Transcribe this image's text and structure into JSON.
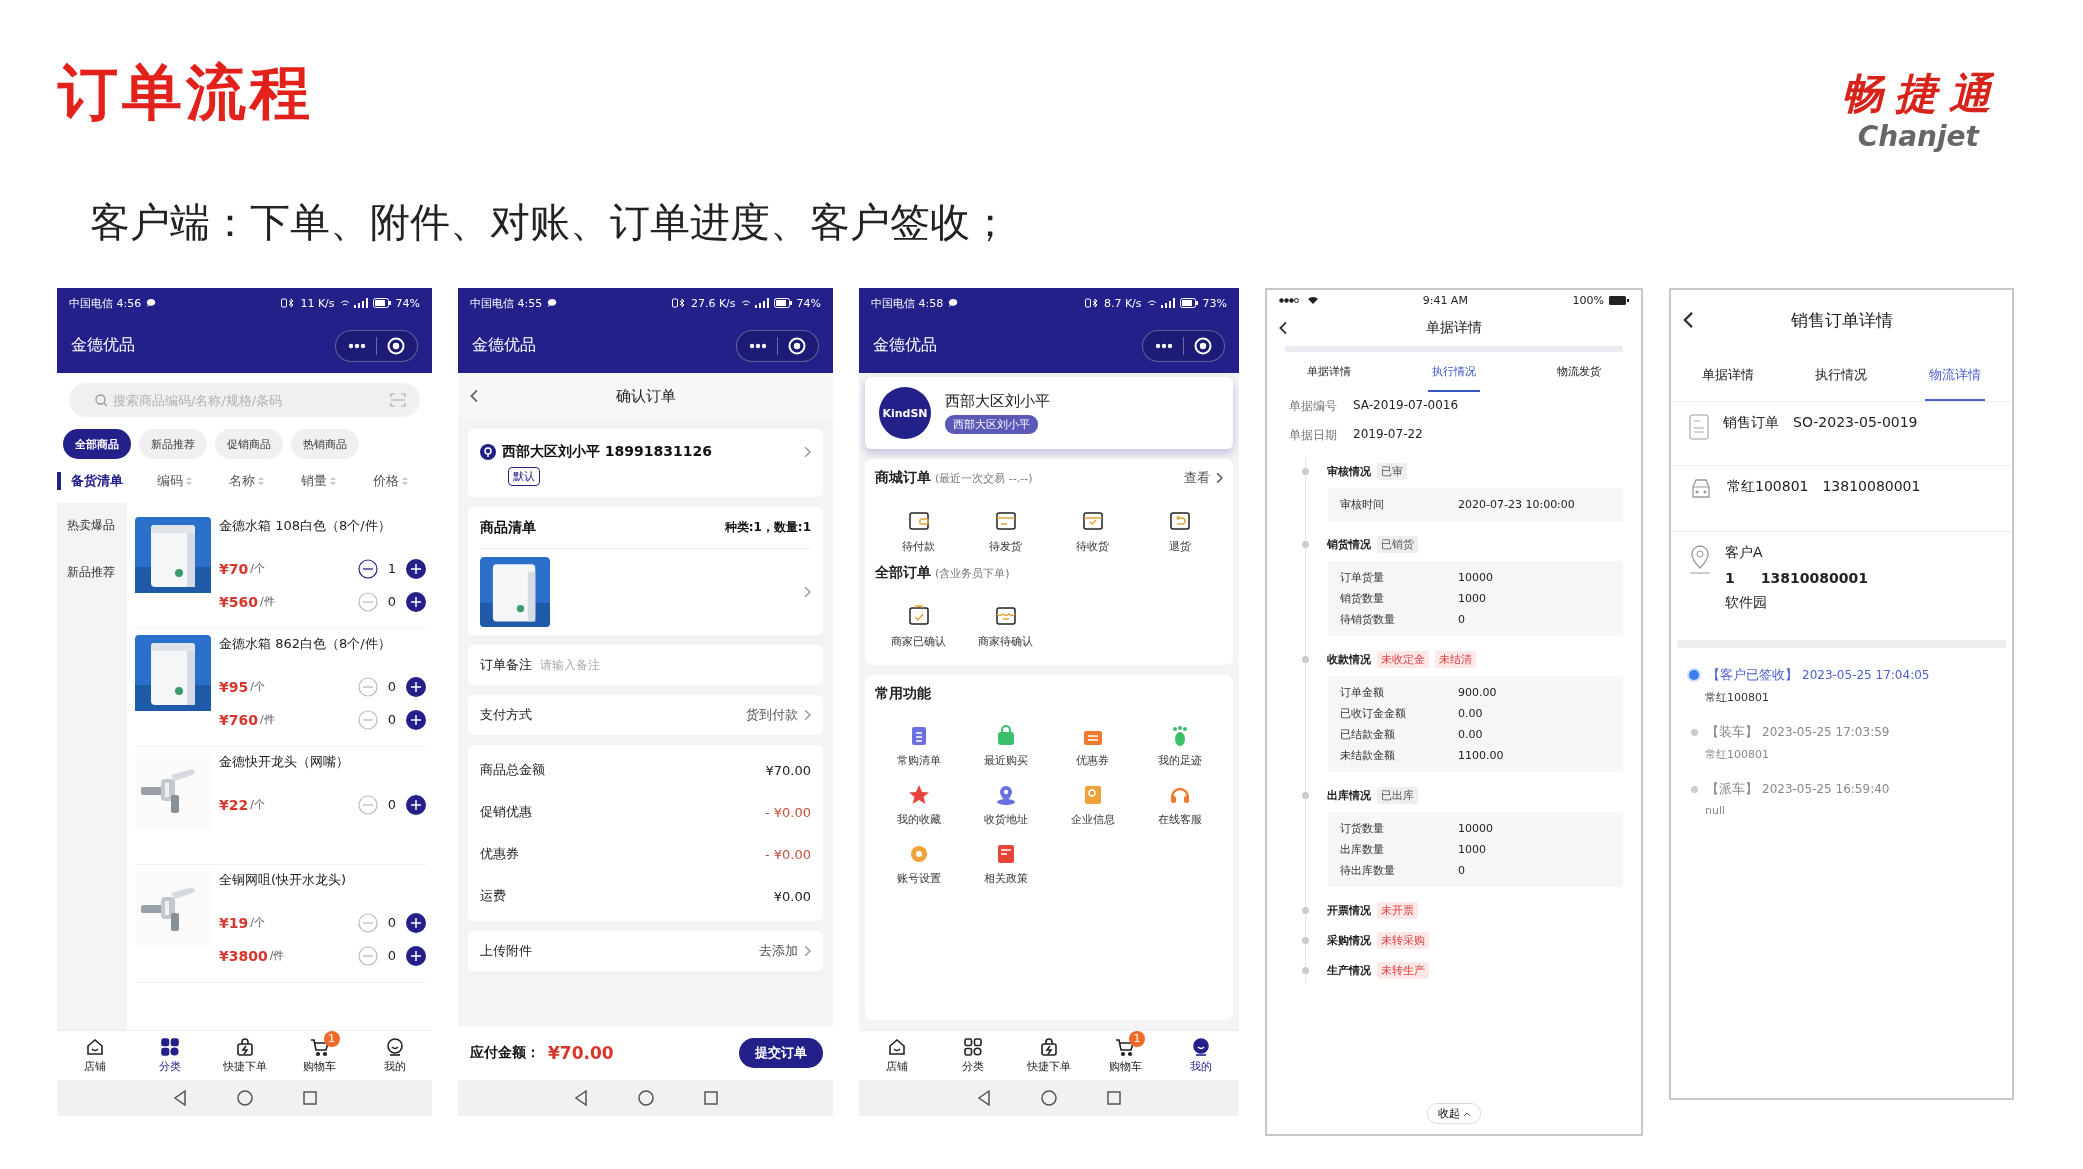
{
  "slide": {
    "title": "订单流程",
    "logo": {
      "cn": "畅捷通",
      "en": "Chanjet"
    },
    "subtitle": "客户端：下单、附件、对账、订单进度、客户签收；"
  },
  "phones": [
    {
      "kind": "catalog",
      "status": {
        "carrier": "中国电信 4:56",
        "speed": "11 K/s",
        "battery": "74%"
      },
      "app_title": "金德优品",
      "search": {
        "placeholder": "搜索商品编码/名称/规格/条码"
      },
      "chips": [
        {
          "label": "全部商品",
          "selected": true
        },
        {
          "label": "新品推荐",
          "selected": false
        },
        {
          "label": "促销商品",
          "selected": false
        },
        {
          "label": "热销商品",
          "selected": false
        }
      ],
      "list_title": "备货清单",
      "sort_columns": [
        "编码",
        "名称",
        "销量",
        "价格"
      ],
      "categories": [
        "热卖爆品",
        "新品推荐"
      ],
      "products": [
        {
          "name": "金德水箱 108白色（8个/件）",
          "image": {
            "kind": "picture"
          },
          "prices": [
            {
              "price": "¥70",
              "unit": "/个",
              "qty": "1",
              "minus_enabled": true
            },
            {
              "price": "¥560",
              "unit": "/件",
              "qty": "0",
              "minus_enabled": false
            }
          ]
        },
        {
          "name": "金德水箱 862白色（8个/件）",
          "image": {
            "kind": "picture"
          },
          "prices": [
            {
              "price": "¥95",
              "unit": "/个",
              "qty": "0",
              "minus_enabled": false
            },
            {
              "price": "¥760",
              "unit": "/件",
              "qty": "0",
              "minus_enabled": false
            }
          ]
        },
        {
          "name": "金德快开龙头（网嘴）",
          "image": {
            "kind": "picture"
          },
          "prices": [
            {
              "price": "¥22",
              "unit": "/个",
              "qty": "0",
              "minus_enabled": false
            }
          ]
        },
        {
          "name": "全铜网咀(快开水龙头)",
          "image": {
            "kind": "picture"
          },
          "prices": [
            {
              "price": "¥19",
              "unit": "/个",
              "qty": "0",
              "minus_enabled": false
            },
            {
              "price": "¥3800",
              "unit": "/件",
              "qty": "0",
              "minus_enabled": false
            }
          ]
        }
      ],
      "tabbar": [
        {
          "label": "店铺",
          "selected": false
        },
        {
          "label": "分类",
          "selected": true
        },
        {
          "label": "快捷下单",
          "selected": false
        },
        {
          "label": "购物车",
          "selected": false,
          "badge": "1"
        },
        {
          "label": "我的",
          "selected": false
        }
      ]
    },
    {
      "kind": "confirm",
      "status": {
        "carrier": "中国电信 4:55",
        "speed": "27.6 K/s",
        "battery": "74%"
      },
      "app_title": "金德优品",
      "page_title": "确认订单",
      "address": {
        "name": "西部大区刘小平 18991831126",
        "tag": "默认"
      },
      "goods": {
        "title": "商品清单",
        "summary": "种类:1，数量:1",
        "image": {
          "kind": "picture"
        }
      },
      "remark": {
        "label": "订单备注",
        "placeholder": "请输入备注"
      },
      "payment": {
        "label": "支付方式",
        "value": "货到付款"
      },
      "amounts": [
        {
          "label": "商品总金额",
          "value": "¥70.00",
          "discount": false
        },
        {
          "label": "促销优惠",
          "value": "- ¥0.00",
          "discount": true
        },
        {
          "label": "优惠券",
          "value": "- ¥0.00",
          "discount": true
        },
        {
          "label": "运费",
          "value": "¥0.00",
          "discount": false
        }
      ],
      "attachment": {
        "label": "上传附件",
        "value": "去添加"
      },
      "footer": {
        "label": "应付金额：",
        "value": "¥70.00",
        "button": "提交订单"
      }
    },
    {
      "kind": "profile",
      "status": {
        "carrier": "中国电信 4:58",
        "speed": "8.7 K/s",
        "battery": "73%"
      },
      "app_title": "金德优品",
      "user": {
        "avatar": "KindSN",
        "name": "西部大区刘小平",
        "tag": "西部大区刘小平"
      },
      "mall_orders": {
        "title": "商城订单",
        "note": "(最近一次交易 --.--)",
        "link": "查看",
        "items": [
          "待付款",
          "待发货",
          "待收货",
          "退货"
        ]
      },
      "all_orders": {
        "title": "全部订单",
        "note": "(含业务员下单)",
        "items": [
          "商家已确认",
          "商家待确认"
        ]
      },
      "functions": {
        "title": "常用功能",
        "items": [
          {
            "label": "常购清单",
            "color": "#6b6fe0"
          },
          {
            "label": "最近购买",
            "color": "#3cbf6a"
          },
          {
            "label": "优惠券",
            "color": "#f07a2e"
          },
          {
            "label": "我的足迹",
            "color": "#3cbf6a"
          },
          {
            "label": "我的收藏",
            "color": "#e8443a"
          },
          {
            "label": "收货地址",
            "color": "#6b6fe0"
          },
          {
            "label": "企业信息",
            "color": "#f0a23a"
          },
          {
            "label": "在线客服",
            "color": "#f07a2e"
          },
          {
            "label": "账号设置",
            "color": "#f0a23a"
          },
          {
            "label": "相关政策",
            "color": "#e8443a"
          }
        ]
      },
      "tabbar": [
        {
          "label": "店铺",
          "selected": false
        },
        {
          "label": "分类",
          "selected": false
        },
        {
          "label": "快捷下单",
          "selected": false
        },
        {
          "label": "购物车",
          "selected": false,
          "badge": "1"
        },
        {
          "label": "我的",
          "selected": true
        }
      ]
    },
    {
      "kind": "execution",
      "status": {
        "time": "9:41 AM",
        "battery": "100%"
      },
      "page_title": "单据详情",
      "tabs": [
        {
          "label": "单据详情",
          "selected": false
        },
        {
          "label": "执行情况",
          "selected": true
        },
        {
          "label": "物流发货",
          "selected": false
        }
      ],
      "fields": [
        {
          "label": "单据编号",
          "value": "SA-2019-07-0016"
        },
        {
          "label": "单据日期",
          "value": "2019-07-22"
        }
      ],
      "sections": [
        {
          "title": "审核情况",
          "tags": [
            {
              "text": "已审",
              "kind": "done"
            }
          ],
          "rows": [
            {
              "label": "审核时间",
              "value": "2020-07-23 10:00:00"
            }
          ]
        },
        {
          "title": "销货情况",
          "tags": [
            {
              "text": "已销货",
              "kind": "done"
            }
          ],
          "rows": [
            {
              "label": "订单货量",
              "value": "10000"
            },
            {
              "label": "销货数量",
              "value": "1000"
            },
            {
              "label": "待销货数量",
              "value": "0"
            }
          ]
        },
        {
          "title": "收款情况",
          "tags": [
            {
              "text": "未收定金",
              "kind": "pending"
            },
            {
              "text": "未结清",
              "kind": "pending"
            }
          ],
          "rows": [
            {
              "label": "订单金额",
              "value": "900.00"
            },
            {
              "label": "已收订金金额",
              "value": "0.00"
            },
            {
              "label": "已结款金额",
              "value": "0.00"
            },
            {
              "label": "未结款金额",
              "value": "1100.00"
            }
          ]
        },
        {
          "title": "出库情况",
          "tags": [
            {
              "text": "已出库",
              "kind": "done"
            }
          ],
          "rows": [
            {
              "label": "订货数量",
              "value": "10000"
            },
            {
              "label": "出库数量",
              "value": "1000"
            },
            {
              "label": "待出库数量",
              "value": "0"
            }
          ]
        },
        {
          "title": "开票情况",
          "tags": [
            {
              "text": "未开票",
              "kind": "pending"
            }
          ]
        },
        {
          "title": "采购情况",
          "tags": [
            {
              "text": "未转采购",
              "kind": "pending"
            }
          ]
        },
        {
          "title": "生产情况",
          "tags": [
            {
              "text": "未转生产",
              "kind": "pending"
            }
          ]
        }
      ],
      "collapse": "收起"
    },
    {
      "kind": "logistics",
      "page_title": "销售订单详情",
      "tabs": [
        {
          "label": "单据详情",
          "selected": false
        },
        {
          "label": "执行情况",
          "selected": false
        },
        {
          "label": "物流详情",
          "selected": true
        }
      ],
      "order": {
        "label": "销售订单",
        "number": "SO-2023-05-0019"
      },
      "driver": {
        "name": "常红100801",
        "phone": "13810080001"
      },
      "customer": {
        "name": "客户A",
        "code": "1",
        "phone": "13810080001",
        "address": "软件园"
      },
      "timeline": [
        {
          "event": "【客户已签收】",
          "time": "2023-05-25 17:04:05",
          "note": "常红100801",
          "current": true
        },
        {
          "event": "【装车】",
          "time": "2023-05-25 17:03:59",
          "note": "常红100801",
          "current": false
        },
        {
          "event": "【派车】",
          "time": "2023-05-25 16:59:40",
          "note": "null",
          "current": false
        }
      ]
    }
  ]
}
